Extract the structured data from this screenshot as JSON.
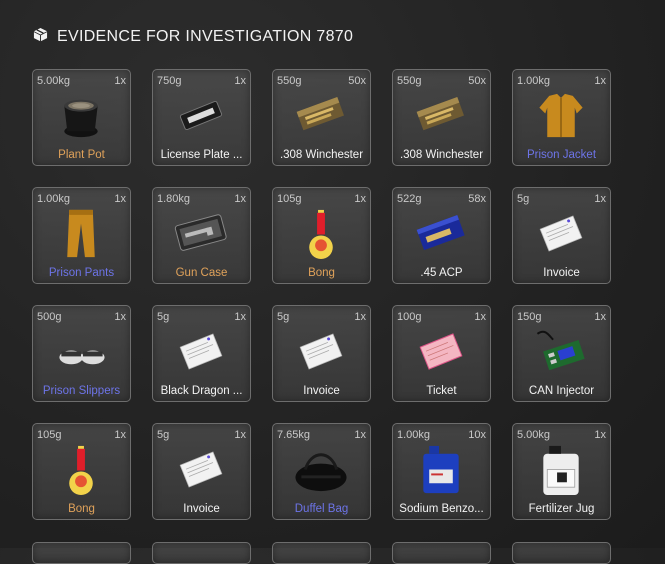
{
  "header": {
    "icon": "box-icon",
    "title": "EVIDENCE FOR INVESTIGATION 7870"
  },
  "colors": {
    "white": "#f3f3f3",
    "orange": "#e0a25a",
    "blue": "#6d74e8"
  },
  "items": [
    {
      "weight": "5.00kg",
      "count": "1x",
      "label": "Plant Pot",
      "color": "orange",
      "icon": "plant-pot-icon"
    },
    {
      "weight": "750g",
      "count": "1x",
      "label": "License Plate ...",
      "color": "white",
      "icon": "license-plate-icon"
    },
    {
      "weight": "550g",
      "count": "50x",
      "label": ".308 Winchester",
      "color": "white",
      "icon": "ammo-box-icon"
    },
    {
      "weight": "550g",
      "count": "50x",
      "label": ".308 Winchester",
      "color": "white",
      "icon": "ammo-box-icon"
    },
    {
      "weight": "1.00kg",
      "count": "1x",
      "label": "Prison Jacket",
      "color": "blue",
      "icon": "jacket-icon"
    },
    {
      "weight": "1.00kg",
      "count": "1x",
      "label": "Prison Pants",
      "color": "blue",
      "icon": "pants-icon"
    },
    {
      "weight": "1.80kg",
      "count": "1x",
      "label": "Gun Case",
      "color": "orange",
      "icon": "gun-case-icon"
    },
    {
      "weight": "105g",
      "count": "1x",
      "label": "Bong",
      "color": "orange",
      "icon": "bong-icon"
    },
    {
      "weight": "522g",
      "count": "58x",
      "label": ".45 ACP",
      "color": "white",
      "icon": "pistol-ammo-icon"
    },
    {
      "weight": "5g",
      "count": "1x",
      "label": "Invoice",
      "color": "white",
      "icon": "paper-icon"
    },
    {
      "weight": "500g",
      "count": "1x",
      "label": "Prison Slippers",
      "color": "blue",
      "icon": "slippers-icon"
    },
    {
      "weight": "5g",
      "count": "1x",
      "label": "Black Dragon ...",
      "color": "white",
      "icon": "paper-icon"
    },
    {
      "weight": "5g",
      "count": "1x",
      "label": "Invoice",
      "color": "white",
      "icon": "paper-icon"
    },
    {
      "weight": "100g",
      "count": "1x",
      "label": "Ticket",
      "color": "white",
      "icon": "ticket-icon"
    },
    {
      "weight": "150g",
      "count": "1x",
      "label": "CAN Injector",
      "color": "white",
      "icon": "circuit-board-icon"
    },
    {
      "weight": "105g",
      "count": "1x",
      "label": "Bong",
      "color": "orange",
      "icon": "bong-icon"
    },
    {
      "weight": "5g",
      "count": "1x",
      "label": "Invoice",
      "color": "white",
      "icon": "paper-icon"
    },
    {
      "weight": "7.65kg",
      "count": "1x",
      "label": "Duffel Bag",
      "color": "blue",
      "icon": "duffel-bag-icon"
    },
    {
      "weight": "1.00kg",
      "count": "10x",
      "label": "Sodium Benzo...",
      "color": "white",
      "icon": "jerrycan-icon"
    },
    {
      "weight": "5.00kg",
      "count": "1x",
      "label": "Fertilizer Jug",
      "color": "white",
      "icon": "jug-icon"
    }
  ]
}
